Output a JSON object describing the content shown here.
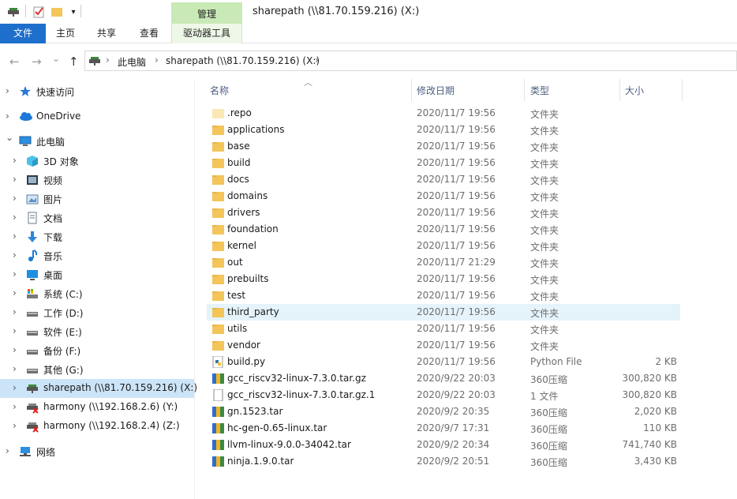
{
  "window": {
    "title": "sharepath (\\\\81.70.159.216) (X:)"
  },
  "ribbon": {
    "context_group": "管理",
    "tabs": [
      "文件",
      "主页",
      "共享",
      "查看",
      "驱动器工具"
    ]
  },
  "address": {
    "back": "←",
    "forward": "→",
    "recent": "⌄",
    "up": "↑",
    "sep": "›",
    "crumbs": [
      "此电脑",
      "sharepath (\\\\81.70.159.216) (X:)"
    ]
  },
  "nav": [
    {
      "label": "快速访问",
      "icon": "star-icon",
      "level": 0
    },
    {
      "label": "OneDrive",
      "icon": "cloud-icon",
      "level": 0
    },
    {
      "label": "此电脑",
      "icon": "computer-icon",
      "level": 0,
      "expanded": true
    },
    {
      "label": "3D 对象",
      "icon": "cube-icon",
      "level": 1
    },
    {
      "label": "视频",
      "icon": "video-icon",
      "level": 1
    },
    {
      "label": "图片",
      "icon": "picture-icon",
      "level": 1
    },
    {
      "label": "文档",
      "icon": "document-icon",
      "level": 1
    },
    {
      "label": "下载",
      "icon": "download-icon",
      "level": 1
    },
    {
      "label": "音乐",
      "icon": "music-icon",
      "level": 1
    },
    {
      "label": "桌面",
      "icon": "desktop-icon",
      "level": 1
    },
    {
      "label": "系统 (C:)",
      "icon": "system-drive-icon",
      "level": 1
    },
    {
      "label": "工作 (D:)",
      "icon": "drive-icon",
      "level": 1
    },
    {
      "label": "软件 (E:)",
      "icon": "drive-icon",
      "level": 1
    },
    {
      "label": "备份 (F:)",
      "icon": "drive-icon",
      "level": 1
    },
    {
      "label": "其他 (G:)",
      "icon": "drive-icon",
      "level": 1
    },
    {
      "label": "sharepath (\\\\81.70.159.216) (X:)",
      "icon": "network-drive-icon",
      "level": 1,
      "selected": true
    },
    {
      "label": "harmony (\\\\192.168.2.6) (Y:)",
      "icon": "disconnected-drive-icon",
      "level": 1
    },
    {
      "label": "harmony (\\\\192.168.2.4) (Z:)",
      "icon": "disconnected-drive-icon",
      "level": 1
    },
    {
      "label": "网络",
      "icon": "network-icon",
      "level": 0
    }
  ],
  "columns": {
    "name": "名称",
    "date": "修改日期",
    "type": "类型",
    "size": "大小"
  },
  "files": [
    {
      "name": ".repo",
      "date": "2020/11/7 19:56",
      "type": "文件夹",
      "size": "",
      "icon": "folder-hidden-icon"
    },
    {
      "name": "applications",
      "date": "2020/11/7 19:56",
      "type": "文件夹",
      "size": "",
      "icon": "folder-icon"
    },
    {
      "name": "base",
      "date": "2020/11/7 19:56",
      "type": "文件夹",
      "size": "",
      "icon": "folder-icon"
    },
    {
      "name": "build",
      "date": "2020/11/7 19:56",
      "type": "文件夹",
      "size": "",
      "icon": "folder-icon"
    },
    {
      "name": "docs",
      "date": "2020/11/7 19:56",
      "type": "文件夹",
      "size": "",
      "icon": "folder-icon"
    },
    {
      "name": "domains",
      "date": "2020/11/7 19:56",
      "type": "文件夹",
      "size": "",
      "icon": "folder-icon"
    },
    {
      "name": "drivers",
      "date": "2020/11/7 19:56",
      "type": "文件夹",
      "size": "",
      "icon": "folder-icon"
    },
    {
      "name": "foundation",
      "date": "2020/11/7 19:56",
      "type": "文件夹",
      "size": "",
      "icon": "folder-icon"
    },
    {
      "name": "kernel",
      "date": "2020/11/7 19:56",
      "type": "文件夹",
      "size": "",
      "icon": "folder-icon"
    },
    {
      "name": "out",
      "date": "2020/11/7 21:29",
      "type": "文件夹",
      "size": "",
      "icon": "folder-icon"
    },
    {
      "name": "prebuilts",
      "date": "2020/11/7 19:56",
      "type": "文件夹",
      "size": "",
      "icon": "folder-icon"
    },
    {
      "name": "test",
      "date": "2020/11/7 19:56",
      "type": "文件夹",
      "size": "",
      "icon": "folder-icon"
    },
    {
      "name": "third_party",
      "date": "2020/11/7 19:56",
      "type": "文件夹",
      "size": "",
      "icon": "folder-icon",
      "hover": true
    },
    {
      "name": "utils",
      "date": "2020/11/7 19:56",
      "type": "文件夹",
      "size": "",
      "icon": "folder-icon"
    },
    {
      "name": "vendor",
      "date": "2020/11/7 19:56",
      "type": "文件夹",
      "size": "",
      "icon": "folder-icon"
    },
    {
      "name": "build.py",
      "date": "2020/11/7 19:56",
      "type": "Python File",
      "size": "2 KB",
      "icon": "python-file-icon"
    },
    {
      "name": "gcc_riscv32-linux-7.3.0.tar.gz",
      "date": "2020/9/22 20:03",
      "type": "360压缩",
      "size": "300,820 KB",
      "icon": "archive-icon"
    },
    {
      "name": "gcc_riscv32-linux-7.3.0.tar.gz.1",
      "date": "2020/9/22 20:03",
      "type": "1 文件",
      "size": "300,820 KB",
      "icon": "file-icon"
    },
    {
      "name": "gn.1523.tar",
      "date": "2020/9/2 20:35",
      "type": "360压缩",
      "size": "2,020 KB",
      "icon": "archive-icon"
    },
    {
      "name": "hc-gen-0.65-linux.tar",
      "date": "2020/9/7 17:31",
      "type": "360压缩",
      "size": "110 KB",
      "icon": "archive-icon"
    },
    {
      "name": "llvm-linux-9.0.0-34042.tar",
      "date": "2020/9/2 20:34",
      "type": "360压缩",
      "size": "741,740 KB",
      "icon": "archive-icon"
    },
    {
      "name": "ninja.1.9.0.tar",
      "date": "2020/9/2 20:51",
      "type": "360压缩",
      "size": "3,430 KB",
      "icon": "archive-icon"
    }
  ]
}
